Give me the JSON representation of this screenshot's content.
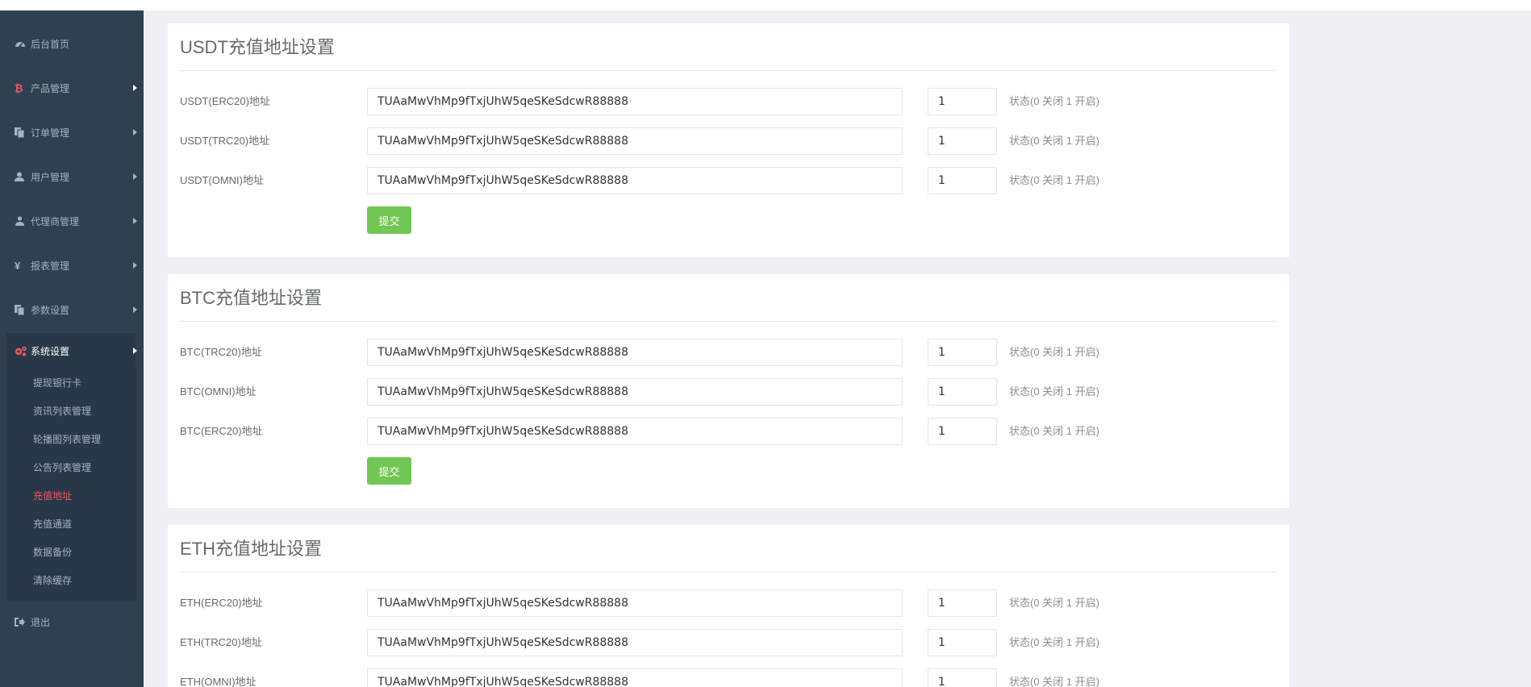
{
  "sidebar": {
    "items": [
      {
        "label": "后台首页",
        "icon": "dashboard-icon"
      },
      {
        "label": "产品管理",
        "icon": "bitcoin-icon"
      },
      {
        "label": "订单管理",
        "icon": "copy-icon"
      },
      {
        "label": "用户管理",
        "icon": "user-icon"
      },
      {
        "label": "代理商管理",
        "icon": "sitemap-icon"
      },
      {
        "label": "报表管理",
        "icon": "yen-icon"
      },
      {
        "label": "参数设置",
        "icon": "copy-icon"
      },
      {
        "label": "系统设置",
        "icon": "cogs-icon"
      },
      {
        "label": "退出",
        "icon": "sign-out-icon"
      }
    ],
    "submenu": [
      "提现银行卡",
      "资讯列表管理",
      "轮播图列表管理",
      "公告列表管理",
      "充值地址",
      "充值通道",
      "数据备份",
      "清除缓存"
    ],
    "current_submenu": "充值地址"
  },
  "colors": {
    "sidebar_bg": "#2f4050",
    "submenu_bg": "#293846",
    "accent_red": "#ed5565",
    "button_green": "#72c653"
  },
  "sections": [
    {
      "title": "USDT充值地址设置",
      "rows": [
        {
          "label": "USDT(ERC20)地址",
          "address": "TUAaMwVhMp9fTxjUhW5qeSKeSdcwR88888",
          "state": "1",
          "hint": "状态(0 关闭 1 开启)"
        },
        {
          "label": "USDT(TRC20)地址",
          "address": "TUAaMwVhMp9fTxjUhW5qeSKeSdcwR88888",
          "state": "1",
          "hint": "状态(0 关闭 1 开启)"
        },
        {
          "label": "USDT(OMNI)地址",
          "address": "TUAaMwVhMp9fTxjUhW5qeSKeSdcwR88888",
          "state": "1",
          "hint": "状态(0 关闭 1 开启)"
        }
      ],
      "submit": "提交"
    },
    {
      "title": "BTC充值地址设置",
      "rows": [
        {
          "label": "BTC(TRC20)地址",
          "address": "TUAaMwVhMp9fTxjUhW5qeSKeSdcwR88888",
          "state": "1",
          "hint": "状态(0 关闭 1 开启)"
        },
        {
          "label": "BTC(OMNI)地址",
          "address": "TUAaMwVhMp9fTxjUhW5qeSKeSdcwR88888",
          "state": "1",
          "hint": "状态(0 关闭 1 开启)"
        },
        {
          "label": "BTC(ERC20)地址",
          "address": "TUAaMwVhMp9fTxjUhW5qeSKeSdcwR88888",
          "state": "1",
          "hint": "状态(0 关闭 1 开启)"
        }
      ],
      "submit": "提交"
    },
    {
      "title": "ETH充值地址设置",
      "rows": [
        {
          "label": "ETH(ERC20)地址",
          "address": "TUAaMwVhMp9fTxjUhW5qeSKeSdcwR88888",
          "state": "1",
          "hint": "状态(0 关闭 1 开启)"
        },
        {
          "label": "ETH(TRC20)地址",
          "address": "TUAaMwVhMp9fTxjUhW5qeSKeSdcwR88888",
          "state": "1",
          "hint": "状态(0 关闭 1 开启)"
        },
        {
          "label": "ETH(OMNI)地址",
          "address": "TUAaMwVhMp9fTxjUhW5qeSKeSdcwR88888",
          "state": "1",
          "hint": "状态(0 关闭 1 开启)"
        }
      ]
    }
  ]
}
